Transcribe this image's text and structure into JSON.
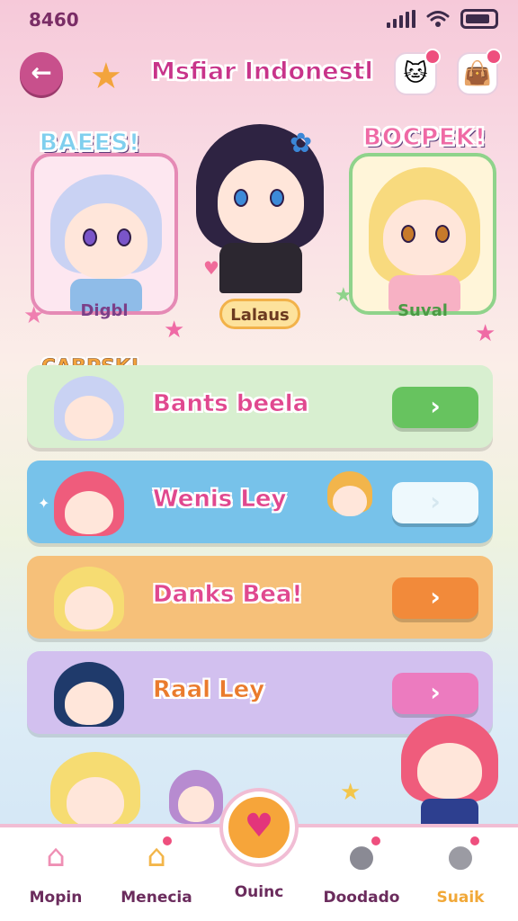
{
  "status": {
    "time": "8460"
  },
  "header": {
    "title": "Msfiar Indonestl",
    "back_icon": "arrow-left-icon",
    "mascot_icon": "cat-mascot-icon",
    "bag_icon": "bag-icon"
  },
  "characters": [
    {
      "badge": "BAEES!",
      "name": "Digbl",
      "badge_color": "#7fcfee",
      "hair": "#c9d2f3",
      "eye": "#7a55c9"
    },
    {
      "badge": "",
      "name": "Lalaus",
      "badge_color": "",
      "hair": "#2e2342",
      "eye": "#3c8ad8"
    },
    {
      "badge": "BOCPEK!",
      "name": "Suval",
      "badge_color": "#ef6aa5",
      "hair": "#f8da7e",
      "eye": "#c77a2a"
    }
  ],
  "tag": {
    "text": "CABPSK!"
  },
  "menu": [
    {
      "label": "Bants beela",
      "bg": "#d8efd0",
      "text_color": "#e0488f",
      "btn_color": "#67c35f",
      "btn_symbol": "›",
      "hair": "#c9d2f3"
    },
    {
      "label": "Wenis Ley",
      "bg": "#77c2ea",
      "text_color": "#e0488f",
      "btn_color": "#eef9fd",
      "btn_symbol": "›",
      "hair": "#ef5c7c"
    },
    {
      "label": "Danks Bea!",
      "bg": "#f6c079",
      "text_color": "#e0488f",
      "btn_color": "#f28a3a",
      "btn_symbol": "›",
      "hair": "#f6dc72"
    },
    {
      "label": "Raal Ley",
      "bg": "#d2c0ef",
      "text_color": "#ea7b2d",
      "btn_color": "#ec7bbf",
      "btn_symbol": "›",
      "hair": "#1f3a6b"
    }
  ],
  "nav": [
    {
      "label": "Mopin",
      "icon": "house-icon",
      "glyph": "⌂"
    },
    {
      "label": "Menecia",
      "icon": "home-badge-icon",
      "glyph": "⌂"
    },
    {
      "label": "Ouinc",
      "icon": "heart-icon",
      "glyph": "♥"
    },
    {
      "label": "Doodado",
      "icon": "blob-icon",
      "glyph": "●"
    },
    {
      "label": "Suaik",
      "icon": "blob-grey-icon",
      "glyph": "●"
    }
  ]
}
